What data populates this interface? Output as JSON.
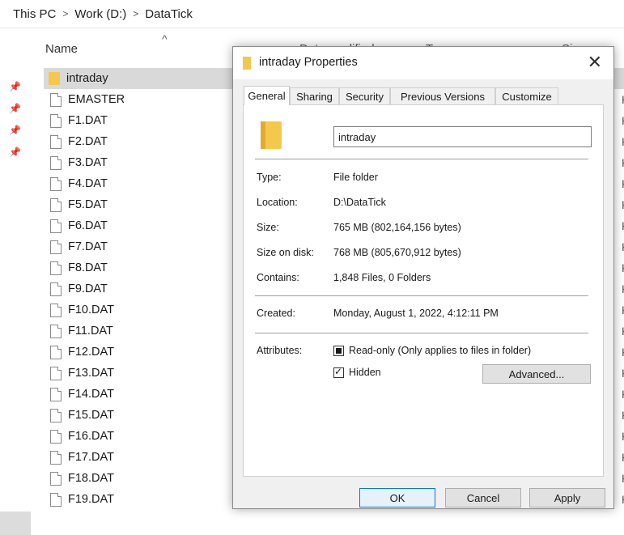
{
  "breadcrumb": {
    "items": [
      "This PC",
      "Work (D:)",
      "DataTick"
    ],
    "separator": ">"
  },
  "columns": {
    "name": "Name",
    "date_modified": "Date modified",
    "type": "Type",
    "size": "Size"
  },
  "files": [
    {
      "name": "intraday",
      "kind": "folder",
      "selected": true
    },
    {
      "name": "EMASTER",
      "kind": "file",
      "size_fragment": "KE"
    },
    {
      "name": "F1.DAT",
      "kind": "file",
      "size_fragment": "KE"
    },
    {
      "name": "F2.DAT",
      "kind": "file",
      "size_fragment": "KE"
    },
    {
      "name": "F3.DAT",
      "kind": "file",
      "size_fragment": "KE"
    },
    {
      "name": "F4.DAT",
      "kind": "file",
      "size_fragment": "KE"
    },
    {
      "name": "F5.DAT",
      "kind": "file",
      "size_fragment": "KE"
    },
    {
      "name": "F6.DAT",
      "kind": "file",
      "size_fragment": "KE"
    },
    {
      "name": "F7.DAT",
      "kind": "file",
      "size_fragment": "KE"
    },
    {
      "name": "F8.DAT",
      "kind": "file",
      "size_fragment": "KE"
    },
    {
      "name": "F9.DAT",
      "kind": "file",
      "size_fragment": "KE"
    },
    {
      "name": "F10.DAT",
      "kind": "file",
      "size_fragment": "KE"
    },
    {
      "name": "F11.DAT",
      "kind": "file",
      "size_fragment": "KE"
    },
    {
      "name": "F12.DAT",
      "kind": "file",
      "size_fragment": "KE"
    },
    {
      "name": "F13.DAT",
      "kind": "file",
      "size_fragment": "KE"
    },
    {
      "name": "F14.DAT",
      "kind": "file",
      "size_fragment": "KE"
    },
    {
      "name": "F15.DAT",
      "kind": "file",
      "size_fragment": "KE"
    },
    {
      "name": "F16.DAT",
      "kind": "file",
      "size_fragment": "KE"
    },
    {
      "name": "F17.DAT",
      "kind": "file",
      "size_fragment": "KE"
    },
    {
      "name": "F18.DAT",
      "kind": "file",
      "size_fragment": "KE"
    },
    {
      "name": "F19.DAT",
      "kind": "file",
      "size_fragment": "KE"
    }
  ],
  "dialog": {
    "title": "intraday Properties",
    "close_glyph": "✕",
    "tabs": [
      "General",
      "Sharing",
      "Security",
      "Previous Versions",
      "Customize"
    ],
    "active_tab": "General",
    "folder_name": "intraday",
    "details": {
      "type_label": "Type:",
      "type_value": "File folder",
      "location_label": "Location:",
      "location_value": "D:\\DataTick",
      "size_label": "Size:",
      "size_value": "765 MB (802,164,156 bytes)",
      "size_on_disk_label": "Size on disk:",
      "size_on_disk_value": "768 MB (805,670,912 bytes)",
      "contains_label": "Contains:",
      "contains_value": "1,848 Files, 0 Folders",
      "created_label": "Created:",
      "created_value": "Monday, August 1, 2022, 4:12:11 PM",
      "attributes_label": "Attributes:"
    },
    "attributes": {
      "readonly_label": "Read-only (Only applies to files in folder)",
      "readonly_state": "indeterminate",
      "hidden_label": "Hidden",
      "hidden_state": "checked",
      "advanced_label": "Advanced..."
    },
    "buttons": {
      "ok": "OK",
      "cancel": "Cancel",
      "apply": "Apply"
    }
  },
  "icons": {
    "pin": "pin-icon",
    "folder": "folder-icon",
    "file": "file-icon",
    "sort": "sort-up-icon"
  },
  "colors": {
    "folder": "#f5c84c",
    "selection": "#d9d9d9",
    "accent": "#0078d7"
  }
}
